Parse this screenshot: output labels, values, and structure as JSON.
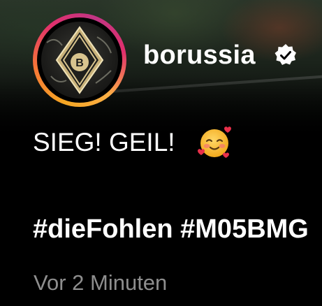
{
  "post": {
    "username": "borussia",
    "verified_icon": "verified-badge-icon",
    "avatar_icon": "borussia-crest-icon",
    "caption": "SIEG! GEIL!",
    "caption_emoji_icon": "smiling-face-with-hearts-icon",
    "hashtags": [
      "#dieFohlen",
      "#M05BMG"
    ],
    "timestamp": "Vor 2 Minuten"
  },
  "colors": {
    "background": "#000000",
    "text": "#ffffff",
    "timestamp": "#8e8e8e",
    "story_ring": [
      "#f5a623",
      "#e1306c",
      "#c13584"
    ]
  }
}
